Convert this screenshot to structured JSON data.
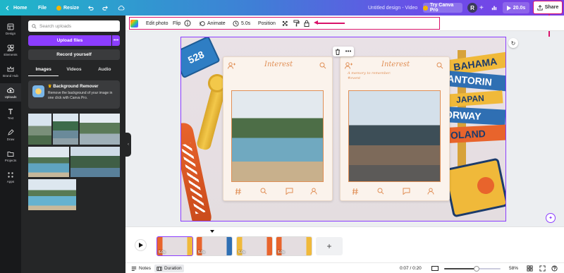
{
  "topbar": {
    "home": "Home",
    "file": "File",
    "resize": "Resize",
    "doc_title": "Untitled design - Video",
    "try_pro": "Try Canva Pro",
    "avatar_initial": "R",
    "duration": "20.0s",
    "share": "Share"
  },
  "rail": {
    "items": [
      {
        "label": "Design",
        "icon": "layout-icon"
      },
      {
        "label": "Elements",
        "icon": "shapes-icon"
      },
      {
        "label": "Brand Hub",
        "icon": "crown-icon"
      },
      {
        "label": "Uploads",
        "icon": "cloud-upload-icon",
        "active": true
      },
      {
        "label": "Text",
        "icon": "text-icon"
      },
      {
        "label": "Draw",
        "icon": "pen-icon"
      },
      {
        "label": "Projects",
        "icon": "folder-icon"
      },
      {
        "label": "Apps",
        "icon": "apps-grid-icon"
      }
    ]
  },
  "panel": {
    "search_placeholder": "Search uploads",
    "upload_label": "Upload files",
    "more": "•••",
    "record_label": "Record yourself",
    "tabs": [
      "Images",
      "Videos",
      "Audio"
    ],
    "promo_title": "Background Remover",
    "promo_text": "Remove the background of your image in one click with Canva Pro."
  },
  "toolbar": {
    "edit_photo": "Edit photo",
    "flip": "Flip",
    "animate": "Animate",
    "duration": "5.0s",
    "position": "Position"
  },
  "canvas": {
    "card_left_title": "Interest",
    "card_right_title": "Interest",
    "caption": "A memory to remember.\n#event",
    "sign_words": [
      "BAHAMA",
      "SANTORIN",
      "JAPAN",
      "NORWAY",
      "OLAND"
    ],
    "tag_number": "528"
  },
  "timeline": {
    "scenes": [
      "5.0s",
      "5.0s",
      "5.0s",
      "5.0s"
    ],
    "add": "+"
  },
  "footer": {
    "notes": "Notes",
    "duration": "Duration",
    "time": "0:07 / 0:20",
    "zoom": "58%",
    "zoom_fraction": 0.58
  },
  "colors": {
    "accent": "#8b3dff",
    "highlight": "#d9126a",
    "card_orange": "#e08f56"
  }
}
